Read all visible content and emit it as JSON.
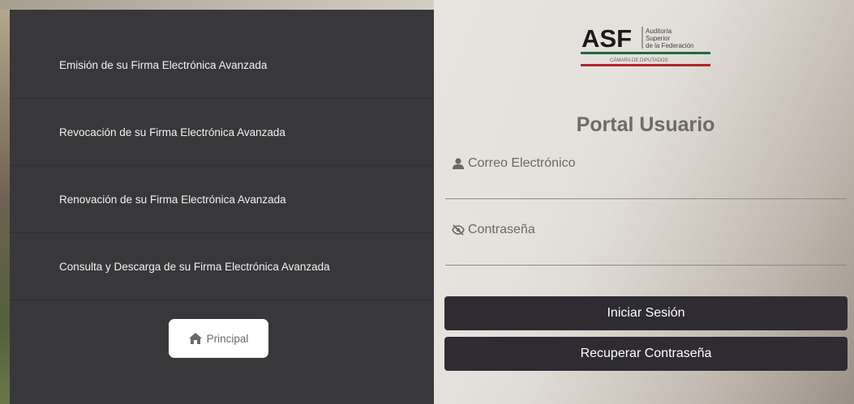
{
  "menu": {
    "items": [
      {
        "label": "Emisión de su Firma Electrónica Avanzada"
      },
      {
        "label": "Revocación de su Firma Electrónica Avanzada"
      },
      {
        "label": "Renovación de su Firma Electrónica Avanzada"
      },
      {
        "label": "Consulta y Descarga de su Firma Electrónica Avanzada"
      }
    ],
    "home_label": "Principal",
    "home_icon": "home-icon"
  },
  "logo": {
    "abbr": "ASF",
    "line1": "Auditoría",
    "line2": "Superior",
    "line3": "de la Federación",
    "sub": "CÁMARA DE DIPUTADOS",
    "colors": {
      "green": "#1f6a3a",
      "red": "#b3232b"
    }
  },
  "login": {
    "title": "Portal Usuario",
    "email_label": "Correo Electrónico",
    "email_icon": "user-icon",
    "password_label": "Contraseña",
    "password_icon": "eye-slash-icon",
    "signin_label": "Iniciar Sesión",
    "recover_label": "Recuperar Contraseña"
  }
}
